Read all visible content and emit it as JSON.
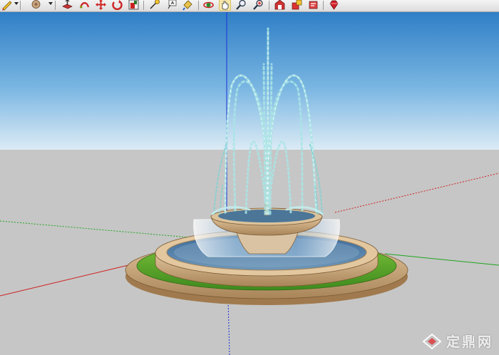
{
  "app": {
    "toolbar": {
      "tools": [
        {
          "name": "pencil-icon"
        },
        {
          "name": "paint-bucket-icon"
        },
        {
          "name": "push-pull-icon"
        },
        {
          "name": "follow-me-icon"
        },
        {
          "name": "move-icon"
        },
        {
          "name": "rotate-icon"
        },
        {
          "name": "offset-icon"
        },
        {
          "name": "tape-measure-icon"
        },
        {
          "name": "text-icon"
        },
        {
          "name": "paint-icon"
        },
        {
          "name": "orbit-icon"
        },
        {
          "name": "pan-icon",
          "active": true
        },
        {
          "name": "zoom-icon"
        },
        {
          "name": "zoom-extents-icon"
        },
        {
          "name": "warehouse-icon"
        },
        {
          "name": "extension-icon"
        },
        {
          "name": "model-info-icon"
        },
        {
          "name": "ruby-icon"
        }
      ]
    },
    "watermark": {
      "text": "定鼎网",
      "logo_icon": "diamond-logo-icon"
    },
    "colors": {
      "sky_top": "#2f7fc6",
      "sky_horizon": "#dcebf5",
      "ground": "#c4c4c4",
      "stone": "#c7a274",
      "grass": "#5aa02c",
      "water": "#a9e6e6",
      "axis_red": "#d02020",
      "axis_green": "#1fa51f",
      "axis_blue": "#1d2fd6"
    }
  }
}
